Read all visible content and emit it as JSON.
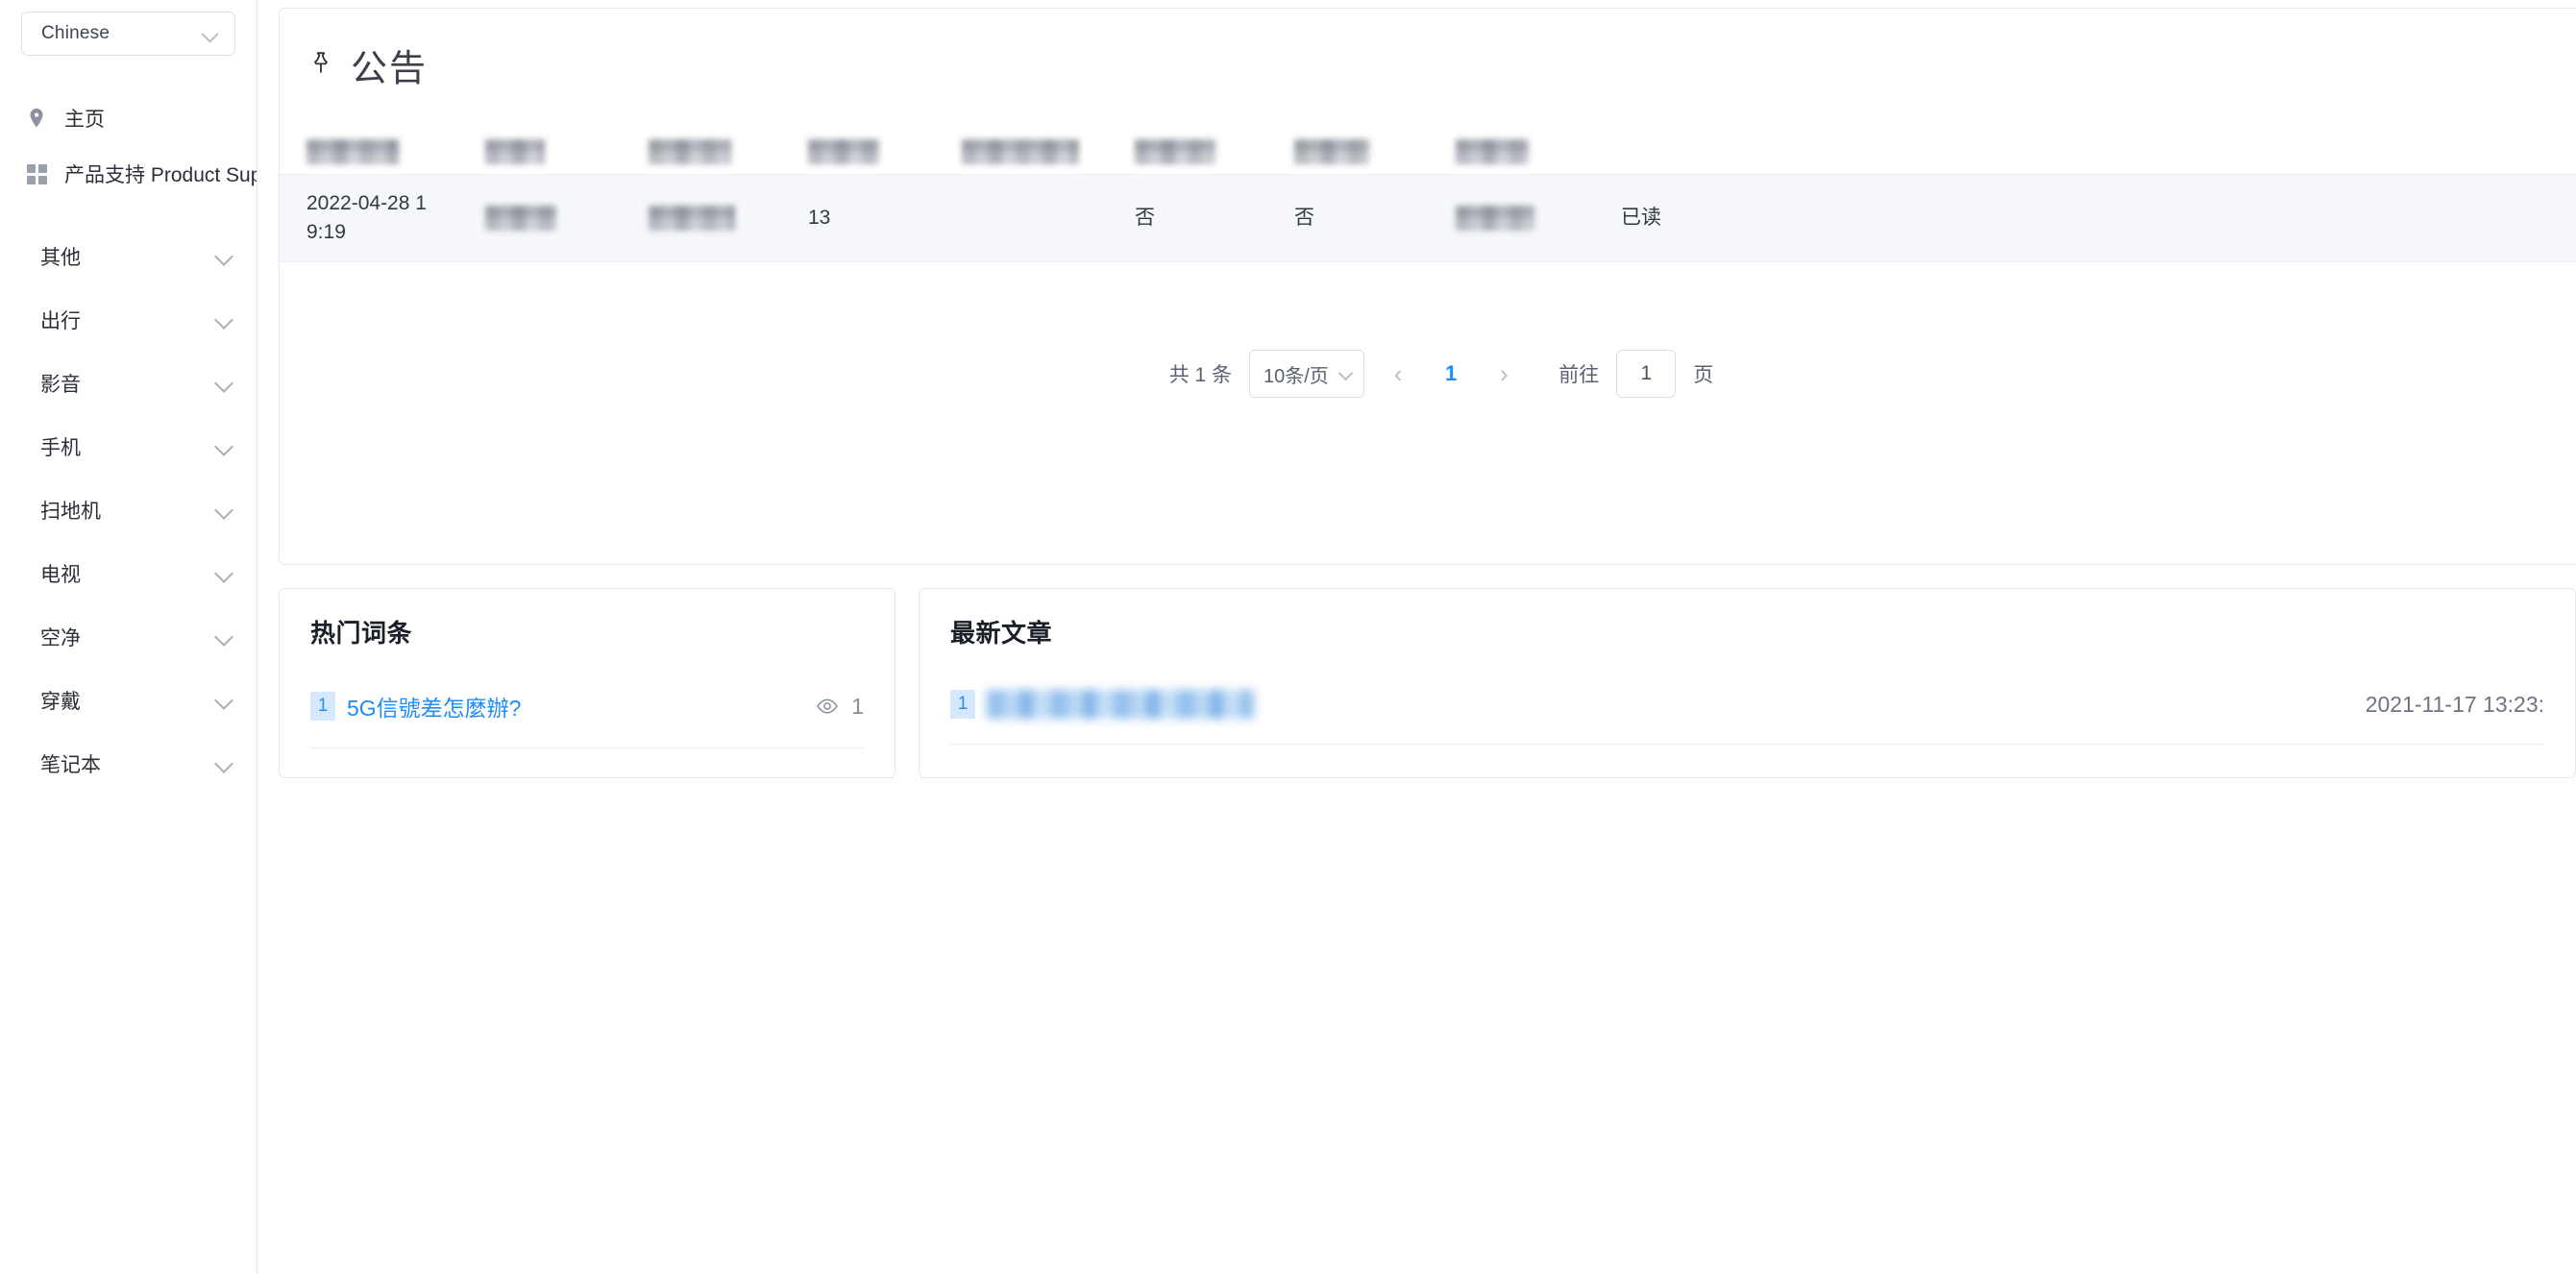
{
  "sidebar": {
    "language_select": {
      "value": "Chinese",
      "icon": "chevron-down-icon"
    },
    "nav": [
      {
        "label": "主页",
        "icon": "location-pin-icon"
      },
      {
        "label": "产品支持 Product Support",
        "icon": "grid-apps-icon"
      }
    ],
    "categories": [
      {
        "label": "其他",
        "icon": "chevron-down-icon"
      },
      {
        "label": "出行",
        "icon": "chevron-down-icon"
      },
      {
        "label": "影音",
        "icon": "chevron-down-icon"
      },
      {
        "label": "手机",
        "icon": "chevron-down-icon"
      },
      {
        "label": "扫地机",
        "icon": "chevron-down-icon"
      },
      {
        "label": "电视",
        "icon": "chevron-down-icon"
      },
      {
        "label": "空净",
        "icon": "chevron-down-icon"
      },
      {
        "label": "穿戴",
        "icon": "chevron-down-icon"
      },
      {
        "label": "笔记本",
        "icon": "chevron-down-icon"
      }
    ]
  },
  "announcement": {
    "icon": "pushpin-icon",
    "title": "公告",
    "table": {
      "headers": [
        {
          "label": "",
          "redacted": true,
          "width": 96
        },
        {
          "label": "",
          "redacted": true,
          "width": 62
        },
        {
          "label": "",
          "redacted": true,
          "width": 86
        },
        {
          "label": "",
          "redacted": true,
          "width": 74
        },
        {
          "label": "",
          "redacted": true,
          "width": 122
        },
        {
          "label": "",
          "redacted": true,
          "width": 84
        },
        {
          "label": "",
          "redacted": true,
          "width": 78
        },
        {
          "label": "",
          "redacted": true,
          "width": 76
        }
      ],
      "rows": [
        {
          "date": "2022-04-28 19:19",
          "cell_b1": {
            "redacted": true,
            "width": 74
          },
          "cell_b2": {
            "redacted": true,
            "width": 90
          },
          "count": "13",
          "cell_b3": {
            "redacted": true,
            "width": 0
          },
          "flag1": "否",
          "flag2": "否",
          "cell_b4": {
            "redacted": true,
            "width": 82
          },
          "status": "已读"
        }
      ]
    },
    "pagination": {
      "total_text": "共 1 条",
      "page_size": "10条/页",
      "page_size_icon": "chevron-down-icon",
      "prev_icon": "chevron-left-icon",
      "next_icon": "chevron-right-icon",
      "current_page": "1",
      "goto_label": "前往",
      "goto_value": "1",
      "page_unit": "页"
    }
  },
  "hot_entries": {
    "title": "热门词条",
    "items": [
      {
        "rank": "1",
        "label": "5G信號差怎麼辦?",
        "views_icon": "eye-icon",
        "views": "1"
      }
    ]
  },
  "latest_articles": {
    "title": "最新文章",
    "items": [
      {
        "rank": "1",
        "label": "",
        "redacted": true,
        "date": "2021-11-17 13:23:"
      }
    ]
  },
  "colors": {
    "accent": "#1c8dfb",
    "row_bg": "#f5f7fa",
    "border": "#e7e9ed",
    "text": "#2b2f38"
  }
}
